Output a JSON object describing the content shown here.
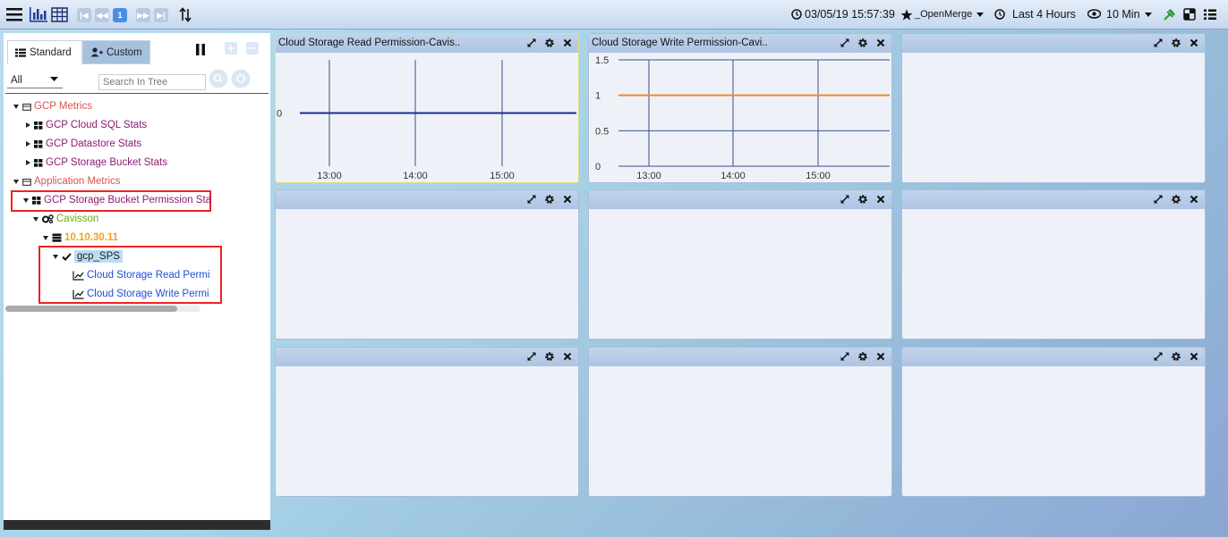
{
  "toolbar": {
    "page_number": "1",
    "datetime": "03/05/19 15:57:39",
    "favorite_label": "_OpenMerge",
    "time_range": "Last 4 Hours",
    "refresh_interval": "10 Min"
  },
  "left_panel": {
    "tabs": {
      "standard": "Standard",
      "custom": "Custom"
    },
    "filter_select": "All",
    "search_placeholder": "Search In Tree",
    "tree": {
      "gcp_metrics": "GCP Metrics",
      "cloud_sql": "GCP Cloud SQL Stats",
      "datastore": "GCP Datastore Stats",
      "storage_bucket": "GCP Storage Bucket Stats",
      "application_metrics": "Application Metrics",
      "bucket_permission": "GCP Storage Bucket Permission Sta",
      "cavisson": "Cavisson",
      "ip": "10.10.30.11",
      "gcp_sps": "gcp_SPS",
      "read_perm": "Cloud Storage Read Permi",
      "write_perm": "Cloud Storage Write Permi"
    }
  },
  "colors": {
    "gcp_metrics": "#d9534f",
    "stats_items": "#8e1b74",
    "application_metrics": "#d9534f",
    "cavisson": "#6aa81a",
    "ip": "#f0a020",
    "graph_link": "#1c4fd6",
    "read_series": "#1f2d8a",
    "write_series": "#f08a24"
  },
  "panels": {
    "p1": {
      "title": "Cloud Storage Read Permission-Cavis.."
    },
    "p2": {
      "title": "Cloud Storage Write Permission-Cavi.."
    }
  },
  "chart_data": [
    {
      "type": "line",
      "title": "Cloud Storage Read Permission-Cavis..",
      "x_ticks": [
        "13:00",
        "14:00",
        "15:00"
      ],
      "y_ticks": [
        "0"
      ],
      "series": [
        {
          "values": [
            0,
            0
          ]
        }
      ],
      "grid": true
    },
    {
      "type": "line",
      "title": "Cloud Storage Write Permission-Cavi..",
      "x_ticks": [
        "13:00",
        "14:00",
        "15:00"
      ],
      "y_ticks": [
        "1.5",
        "1",
        "0.5",
        "0"
      ],
      "ylim": [
        0,
        1.5
      ],
      "series": [
        {
          "values": [
            1,
            1
          ]
        }
      ],
      "grid": true
    }
  ]
}
